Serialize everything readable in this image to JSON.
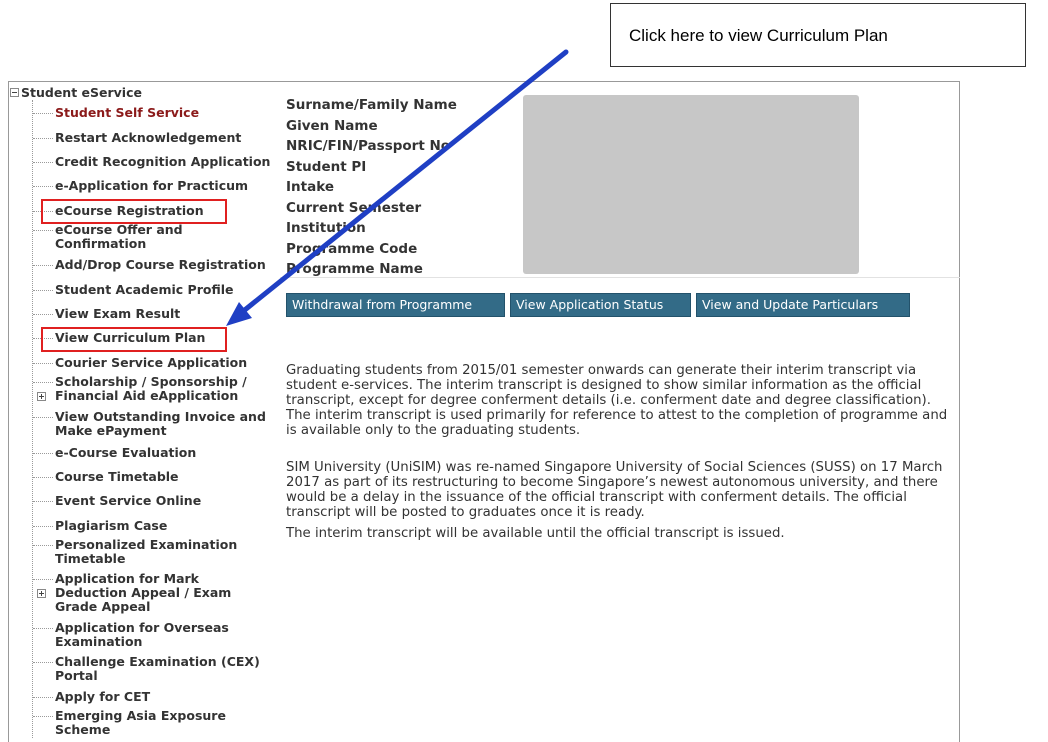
{
  "callout": {
    "text": "Click here to view Curriculum Plan"
  },
  "sidebar": {
    "root_label": "Student eService",
    "items": [
      {
        "label": "Student Self Service",
        "active": true
      },
      {
        "label": "Restart Acknowledgement"
      },
      {
        "label": "Credit Recognition Application"
      },
      {
        "label": "e-Application for Practicum"
      },
      {
        "label": "eCourse Registration",
        "highlighted": true
      },
      {
        "label": "eCourse Offer and Confirmation"
      },
      {
        "label": "Add/Drop Course Registration"
      },
      {
        "label": "Student Academic Profile"
      },
      {
        "label": "View Exam Result"
      },
      {
        "label": "View Curriculum Plan",
        "highlighted": true
      },
      {
        "label": "Courier Service Application"
      },
      {
        "label": "Scholarship / Sponsorship / Financial Aid eApplication",
        "expandable": true
      },
      {
        "label": "View Outstanding Invoice and Make ePayment"
      },
      {
        "label": "e-Course Evaluation"
      },
      {
        "label": "Course Timetable"
      },
      {
        "label": "Event Service Online"
      },
      {
        "label": "Plagiarism Case"
      },
      {
        "label": "Personalized Examination Timetable"
      },
      {
        "label": "Application for Mark Deduction Appeal / Exam Grade Appeal",
        "expandable": true
      },
      {
        "label": "Application for Overseas Examination"
      },
      {
        "label": "Challenge Examination (CEX) Portal"
      },
      {
        "label": "Apply for CET"
      },
      {
        "label": "Emerging Asia Exposure Scheme"
      }
    ]
  },
  "profile": {
    "labels": [
      "Surname/Family Name",
      "Given Name",
      "NRIC/FIN/Passport No",
      "Student PI",
      "Intake",
      "Current Semester",
      "Institution",
      "Programme Code",
      "Programme Name"
    ]
  },
  "buttons": {
    "withdrawal": "Withdrawal from Programme",
    "view_status": "View Application Status",
    "view_update": "View and Update Particulars"
  },
  "notices": [
    "Graduating students from 2015/01 semester onwards can generate their interim transcript via student e-services. The interim transcript is designed to show similar information as the official transcript, except for degree conferment details (i.e. conferment date and degree classification). The interim transcript is used primarily for reference to attest to the completion of programme and is available only to the graduating students.",
    "SIM University (UniSIM) was re-named Singapore University of Social Sciences (SUSS) on 17 March 2017 as part of its restructuring to become Singapore’s newest autonomous university, and there would be a delay in the issuance of the official transcript with conferment details. The official transcript will be posted to graduates once it is ready.",
    "The interim transcript will be available until the official transcript is issued."
  ],
  "colors": {
    "arrow": "#1f3fc4",
    "highlight": "#e02020",
    "button": "#336b87",
    "active_item": "#8b1a1a"
  }
}
